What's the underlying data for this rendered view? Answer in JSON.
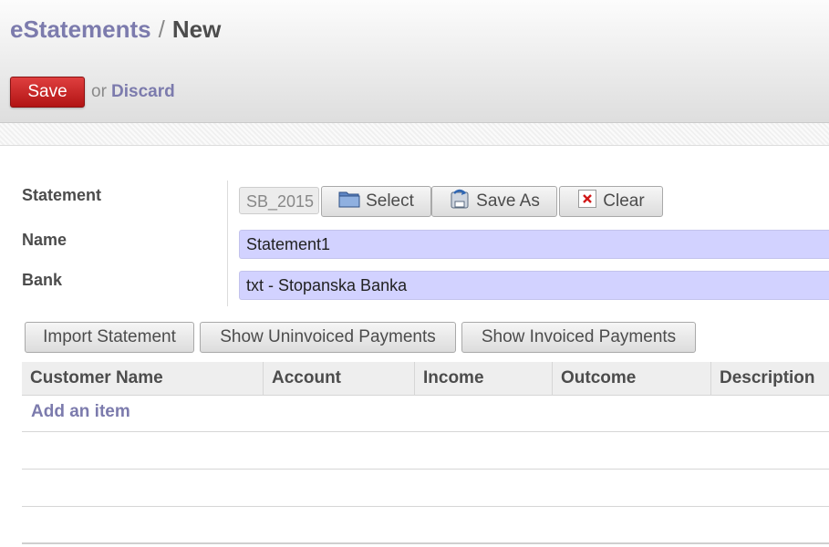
{
  "breadcrumb": {
    "parent": "eStatements",
    "separator": "/",
    "current": "New"
  },
  "toolbar": {
    "save_label": "Save",
    "or_text": "or",
    "discard_label": "Discard"
  },
  "form": {
    "statement_label": "Statement",
    "statement_value": "SB_2015",
    "select_label": "Select",
    "save_as_label": "Save As",
    "clear_label": "Clear",
    "name_label": "Name",
    "name_value": "Statement1",
    "bank_label": "Bank",
    "bank_value": "txt - Stopanska Banka"
  },
  "actions": {
    "import": "Import Statement",
    "uninvoiced": "Show Uninvoiced Payments",
    "invoiced": "Show Invoiced Payments"
  },
  "table": {
    "columns": [
      "Customer Name",
      "Account",
      "Income",
      "Outcome",
      "Description"
    ],
    "add_item": "Add an item"
  },
  "colors": {
    "accent": "#7c7bad",
    "save_button": "#c92a2a",
    "input_bg": "#d2d2ff"
  },
  "icons": {
    "select": "folder-icon",
    "save_as": "save-as-icon",
    "clear": "clear-icon"
  }
}
